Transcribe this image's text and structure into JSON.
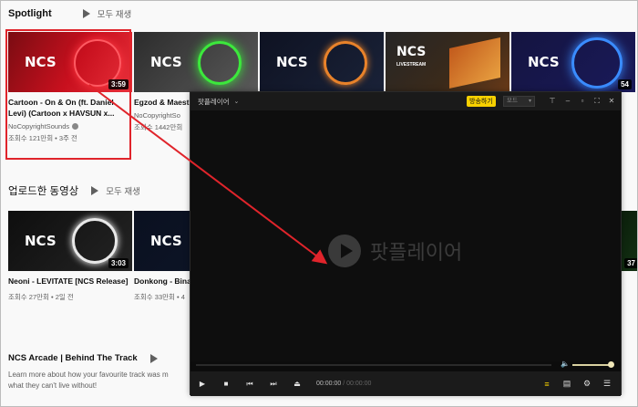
{
  "spotlight": {
    "title": "Spotlight",
    "play_all": "모두 재생"
  },
  "uploads": {
    "title": "업로드한 동영상",
    "play_all": "모두 재생"
  },
  "arcade": {
    "title": "NCS Arcade | Behind The Track",
    "desc_line1": "Learn more about how your favourite track was m",
    "desc_line2": "what they can't live without!"
  },
  "spotlight_videos": [
    {
      "title": "Cartoon - On & On (ft. Daniel Levi) (Cartoon x HAVSUN x...",
      "channel": "NoCopyrightSounds",
      "meta": "조회수 121만회 • 3주 전",
      "duration": "3:59",
      "bg": "#c8101e",
      "ring": "#e8303a"
    },
    {
      "title": "Egzod & Maest Royalty (ft. Neo",
      "channel": "NoCopyrightSo",
      "meta": "조회수 1442만회",
      "duration": "",
      "bg": "#4a4a4a",
      "ring": "#3ce83c"
    },
    {
      "title": "",
      "channel": "",
      "meta": "",
      "duration": "",
      "bg": "#1a2238",
      "ring": "#e8822a"
    },
    {
      "title": "",
      "channel": "",
      "meta": "",
      "duration": "",
      "bg": "#2a2a2a",
      "ring": ""
    },
    {
      "title": "",
      "channel": "",
      "meta": "",
      "duration": "54",
      "bg": "#1a1a5a",
      "ring": "#3a8cff"
    }
  ],
  "upload_videos": [
    {
      "title": "Neoni - LEVITATE [NCS Release]",
      "channel": "",
      "meta": "조회수 27만회 • 2일 전",
      "duration": "3:03",
      "bg": "#1a1a1a",
      "ring": "#e0e0e0"
    },
    {
      "title": "Donkong - Bina HANNY) [NCS R",
      "channel": "",
      "meta": "조회수 33만회 • 4",
      "duration": "",
      "bg": "#0e1628",
      "ring": ""
    }
  ],
  "edge_durations": [
    "37"
  ],
  "player": {
    "app_name": "팟플레이어",
    "badge": "방송하기",
    "mode": "모드",
    "logo_text": "팟플레이어",
    "time_current": "00:00:00",
    "time_sep": "/",
    "time_total": "00:00:00",
    "volume_level": 0.92,
    "accent": "#f7d000"
  },
  "colors": {
    "highlight": "#e0242b",
    "arrow": "#e0242b"
  }
}
